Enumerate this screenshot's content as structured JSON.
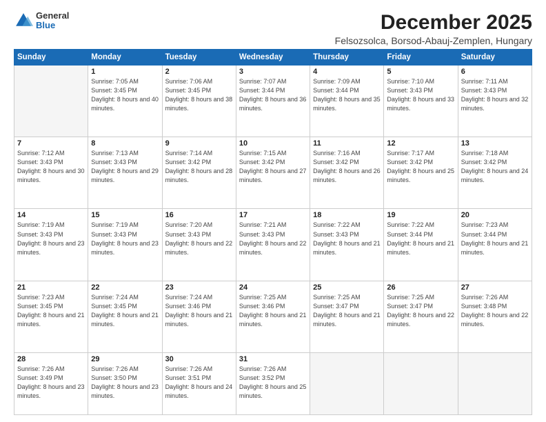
{
  "logo": {
    "general": "General",
    "blue": "Blue"
  },
  "title": "December 2025",
  "location": "Felsozsolca, Borsod-Abauj-Zemplen, Hungary",
  "days_of_week": [
    "Sunday",
    "Monday",
    "Tuesday",
    "Wednesday",
    "Thursday",
    "Friday",
    "Saturday"
  ],
  "weeks": [
    [
      {
        "day": "",
        "empty": true
      },
      {
        "day": "1",
        "sunrise": "7:05 AM",
        "sunset": "3:45 PM",
        "daylight": "8 hours and 40 minutes."
      },
      {
        "day": "2",
        "sunrise": "7:06 AM",
        "sunset": "3:45 PM",
        "daylight": "8 hours and 38 minutes."
      },
      {
        "day": "3",
        "sunrise": "7:07 AM",
        "sunset": "3:44 PM",
        "daylight": "8 hours and 36 minutes."
      },
      {
        "day": "4",
        "sunrise": "7:09 AM",
        "sunset": "3:44 PM",
        "daylight": "8 hours and 35 minutes."
      },
      {
        "day": "5",
        "sunrise": "7:10 AM",
        "sunset": "3:43 PM",
        "daylight": "8 hours and 33 minutes."
      },
      {
        "day": "6",
        "sunrise": "7:11 AM",
        "sunset": "3:43 PM",
        "daylight": "8 hours and 32 minutes."
      }
    ],
    [
      {
        "day": "7",
        "sunrise": "7:12 AM",
        "sunset": "3:43 PM",
        "daylight": "8 hours and 30 minutes."
      },
      {
        "day": "8",
        "sunrise": "7:13 AM",
        "sunset": "3:43 PM",
        "daylight": "8 hours and 29 minutes."
      },
      {
        "day": "9",
        "sunrise": "7:14 AM",
        "sunset": "3:42 PM",
        "daylight": "8 hours and 28 minutes."
      },
      {
        "day": "10",
        "sunrise": "7:15 AM",
        "sunset": "3:42 PM",
        "daylight": "8 hours and 27 minutes."
      },
      {
        "day": "11",
        "sunrise": "7:16 AM",
        "sunset": "3:42 PM",
        "daylight": "8 hours and 26 minutes."
      },
      {
        "day": "12",
        "sunrise": "7:17 AM",
        "sunset": "3:42 PM",
        "daylight": "8 hours and 25 minutes."
      },
      {
        "day": "13",
        "sunrise": "7:18 AM",
        "sunset": "3:42 PM",
        "daylight": "8 hours and 24 minutes."
      }
    ],
    [
      {
        "day": "14",
        "sunrise": "7:19 AM",
        "sunset": "3:43 PM",
        "daylight": "8 hours and 23 minutes."
      },
      {
        "day": "15",
        "sunrise": "7:19 AM",
        "sunset": "3:43 PM",
        "daylight": "8 hours and 23 minutes."
      },
      {
        "day": "16",
        "sunrise": "7:20 AM",
        "sunset": "3:43 PM",
        "daylight": "8 hours and 22 minutes."
      },
      {
        "day": "17",
        "sunrise": "7:21 AM",
        "sunset": "3:43 PM",
        "daylight": "8 hours and 22 minutes."
      },
      {
        "day": "18",
        "sunrise": "7:22 AM",
        "sunset": "3:43 PM",
        "daylight": "8 hours and 21 minutes."
      },
      {
        "day": "19",
        "sunrise": "7:22 AM",
        "sunset": "3:44 PM",
        "daylight": "8 hours and 21 minutes."
      },
      {
        "day": "20",
        "sunrise": "7:23 AM",
        "sunset": "3:44 PM",
        "daylight": "8 hours and 21 minutes."
      }
    ],
    [
      {
        "day": "21",
        "sunrise": "7:23 AM",
        "sunset": "3:45 PM",
        "daylight": "8 hours and 21 minutes."
      },
      {
        "day": "22",
        "sunrise": "7:24 AM",
        "sunset": "3:45 PM",
        "daylight": "8 hours and 21 minutes."
      },
      {
        "day": "23",
        "sunrise": "7:24 AM",
        "sunset": "3:46 PM",
        "daylight": "8 hours and 21 minutes."
      },
      {
        "day": "24",
        "sunrise": "7:25 AM",
        "sunset": "3:46 PM",
        "daylight": "8 hours and 21 minutes."
      },
      {
        "day": "25",
        "sunrise": "7:25 AM",
        "sunset": "3:47 PM",
        "daylight": "8 hours and 21 minutes."
      },
      {
        "day": "26",
        "sunrise": "7:25 AM",
        "sunset": "3:47 PM",
        "daylight": "8 hours and 22 minutes."
      },
      {
        "day": "27",
        "sunrise": "7:26 AM",
        "sunset": "3:48 PM",
        "daylight": "8 hours and 22 minutes."
      }
    ],
    [
      {
        "day": "28",
        "sunrise": "7:26 AM",
        "sunset": "3:49 PM",
        "daylight": "8 hours and 23 minutes."
      },
      {
        "day": "29",
        "sunrise": "7:26 AM",
        "sunset": "3:50 PM",
        "daylight": "8 hours and 23 minutes."
      },
      {
        "day": "30",
        "sunrise": "7:26 AM",
        "sunset": "3:51 PM",
        "daylight": "8 hours and 24 minutes."
      },
      {
        "day": "31",
        "sunrise": "7:26 AM",
        "sunset": "3:52 PM",
        "daylight": "8 hours and 25 minutes."
      },
      {
        "day": "",
        "empty": true
      },
      {
        "day": "",
        "empty": true
      },
      {
        "day": "",
        "empty": true
      }
    ]
  ]
}
